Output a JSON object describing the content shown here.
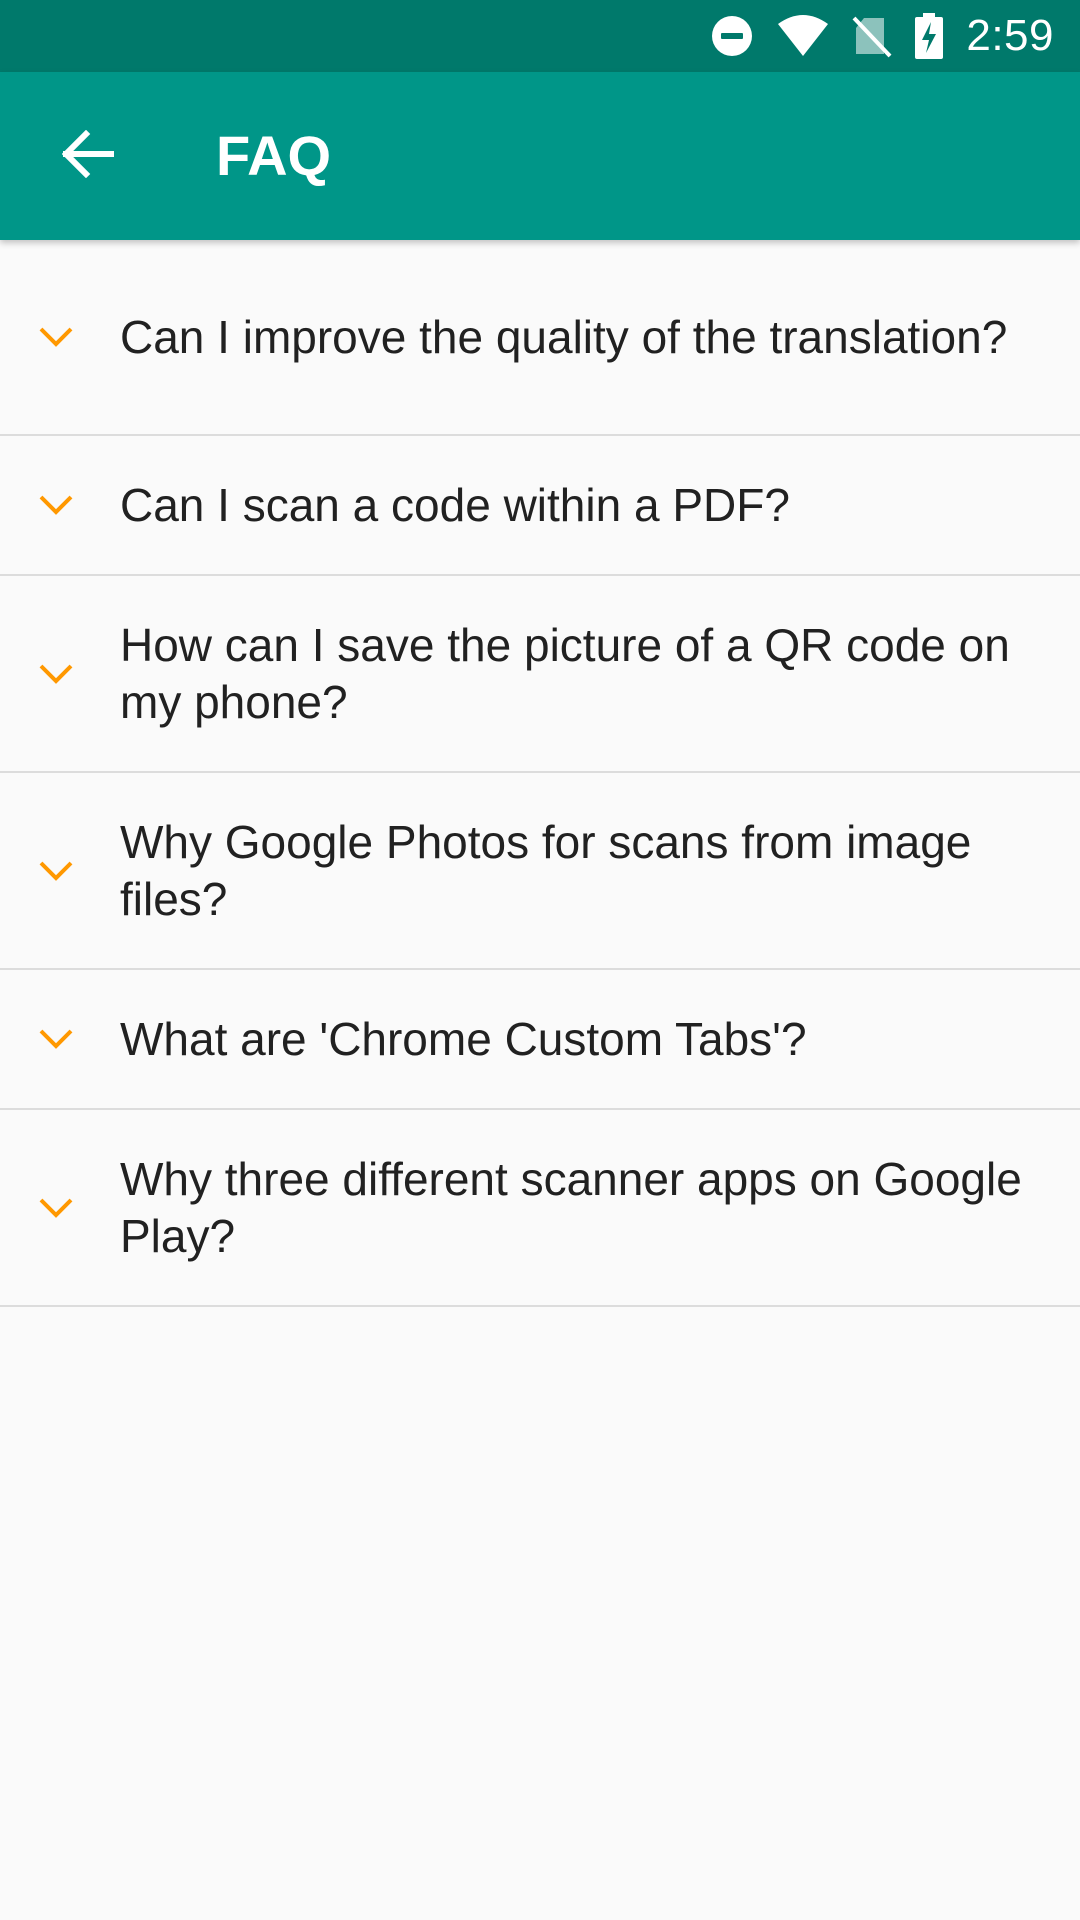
{
  "status_bar": {
    "time": "2:59",
    "icons": [
      "do-not-disturb-icon",
      "wifi-icon",
      "no-sim-icon",
      "battery-charging-icon"
    ]
  },
  "app_bar": {
    "title": "FAQ",
    "back_icon": "arrow-back-icon"
  },
  "colors": {
    "status_bar": "#00796b",
    "app_bar": "#009688",
    "accent": "#ff9800",
    "background": "#fafafa",
    "divider": "#dcdcdc",
    "text": "#212121"
  },
  "faq": {
    "items": [
      {
        "question": "Can I improve the quality of the translation?",
        "icon": "chevron-down-icon"
      },
      {
        "question": "Can I scan a code within a PDF?",
        "icon": "chevron-down-icon"
      },
      {
        "question": "How can I save the picture of a QR code on my phone?",
        "icon": "chevron-down-icon"
      },
      {
        "question": "Why Google Photos for scans from image files?",
        "icon": "chevron-down-icon"
      },
      {
        "question": "What are 'Chrome Custom Tabs'?",
        "icon": "chevron-down-icon"
      },
      {
        "question": "Why three different scanner apps on Google Play?",
        "icon": "chevron-down-icon"
      }
    ]
  }
}
